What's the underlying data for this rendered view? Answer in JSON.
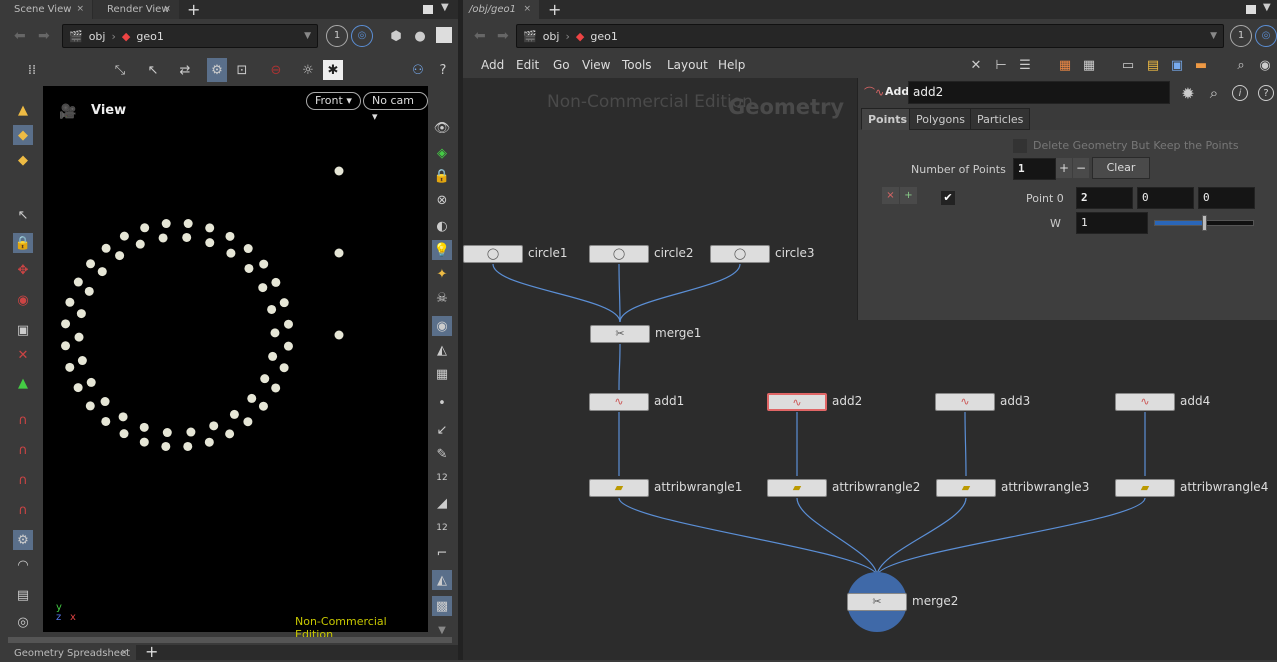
{
  "left_panel": {
    "tabs": [
      "Scene View",
      "Render View"
    ],
    "path": [
      "obj",
      "geo1"
    ],
    "pin": "1",
    "view_label": "View",
    "view_menu": "Front",
    "cam_menu": "No cam",
    "watermark": "Non-Commercial Edition",
    "axes": {
      "x": "x",
      "y": "y",
      "z": "z"
    },
    "bottom_tab": "Geometry Spreadsheet"
  },
  "right_panel": {
    "tab": "/obj/geo1",
    "path": [
      "obj",
      "geo1"
    ],
    "pin": "1",
    "menu": [
      "Add",
      "Edit",
      "Go",
      "View",
      "Tools",
      "Layout",
      "Help"
    ],
    "watermark": "Non-Commercial Edition",
    "context_label": "Geometry"
  },
  "parameters": {
    "node_type": "Add",
    "node_name": "add2",
    "tabs": [
      "Points",
      "Polygons",
      "Particles"
    ],
    "active_tab": "Points",
    "delete_geo_label": "Delete Geometry But Keep the Points",
    "delete_geo_checked": false,
    "num_points_label": "Number of Points",
    "num_points": "1",
    "plus": "+",
    "minus": "−",
    "clear": "Clear",
    "point0_label": "Point 0",
    "point0": [
      "2",
      "0",
      "0"
    ],
    "point0_enabled": true,
    "w_label": "W",
    "w": "1",
    "w_slider_fraction": 0.5
  },
  "nodes": [
    {
      "name": "circle1",
      "type": "circle"
    },
    {
      "name": "circle2",
      "type": "circle"
    },
    {
      "name": "circle3",
      "type": "circle"
    },
    {
      "name": "merge1",
      "type": "merge"
    },
    {
      "name": "add1",
      "type": "add"
    },
    {
      "name": "add2",
      "type": "add",
      "selected": true
    },
    {
      "name": "add3",
      "type": "add"
    },
    {
      "name": "add4",
      "type": "add"
    },
    {
      "name": "attribwrangle1",
      "type": "wrangle"
    },
    {
      "name": "attribwrangle2",
      "type": "wrangle"
    },
    {
      "name": "attribwrangle3",
      "type": "wrangle"
    },
    {
      "name": "attribwrangle4",
      "type": "wrangle"
    },
    {
      "name": "merge2",
      "type": "merge",
      "display": true
    }
  ],
  "connections": [
    [
      "circle1",
      "merge1"
    ],
    [
      "circle2",
      "merge1"
    ],
    [
      "circle3",
      "merge1"
    ],
    [
      "merge1",
      "add1"
    ],
    [
      "add1",
      "attribwrangle1"
    ],
    [
      "add2",
      "attribwrangle2"
    ],
    [
      "add3",
      "attribwrangle3"
    ],
    [
      "add4",
      "attribwrangle4"
    ],
    [
      "attribwrangle1",
      "merge2"
    ],
    [
      "attribwrangle2",
      "merge2"
    ],
    [
      "attribwrangle3",
      "merge2"
    ],
    [
      "attribwrangle4",
      "merge2"
    ]
  ],
  "colors": {
    "wire": "#5b8fd6",
    "viewport_bg": "#000000",
    "point": "#e6e6d6",
    "watermark": "#c8c800",
    "selected": "#e06666"
  }
}
